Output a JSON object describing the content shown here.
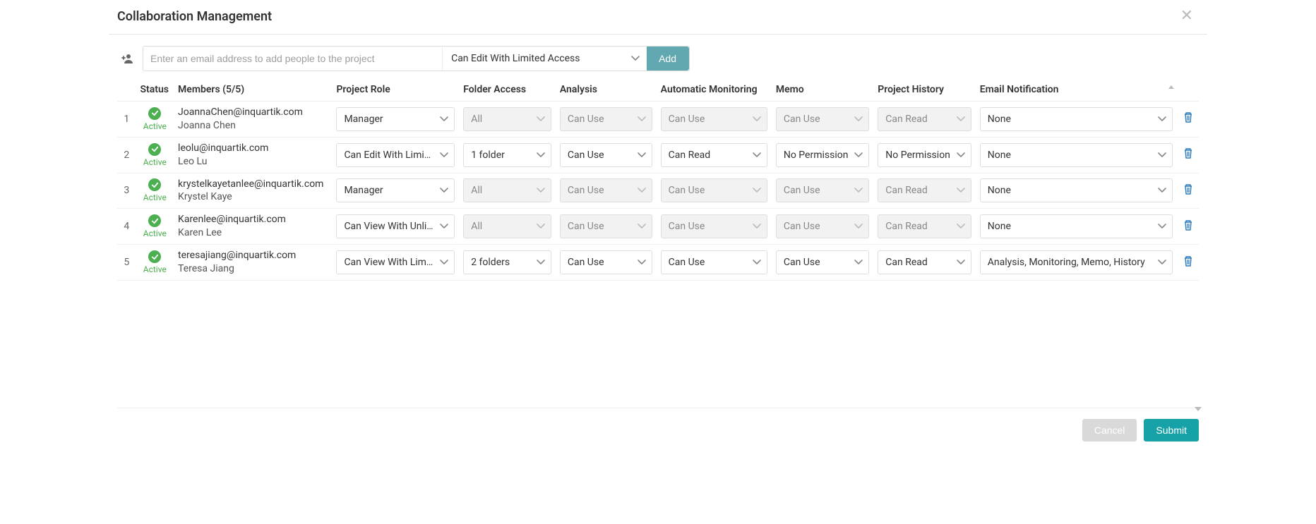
{
  "title": "Collaboration Management",
  "addRow": {
    "placeholder": "Enter an email address to add people to the project",
    "roleSelected": "Can Edit With Limited Access",
    "addLabel": "Add"
  },
  "columns": {
    "status": "Status",
    "members": "Members (5/5)",
    "role": "Project Role",
    "folder": "Folder Access",
    "analysis": "Analysis",
    "monitoring": "Automatic Monitoring",
    "memo": "Memo",
    "history": "Project History",
    "emailNotif": "Email Notification"
  },
  "statusLabel": "Active",
  "rows": [
    {
      "idx": "1",
      "email": "JoannaChen@inquartik.com",
      "name": "Joanna Chen",
      "role": {
        "value": "Manager",
        "disabled": false
      },
      "folder": {
        "value": "All",
        "disabled": true
      },
      "analysis": {
        "value": "Can Use",
        "disabled": true
      },
      "monitoring": {
        "value": "Can Use",
        "disabled": true
      },
      "memo": {
        "value": "Can Use",
        "disabled": true
      },
      "history": {
        "value": "Can Read",
        "disabled": true
      },
      "emailNotif": {
        "value": "None",
        "disabled": false
      }
    },
    {
      "idx": "2",
      "email": "leolu@inquartik.com",
      "name": "Leo Lu",
      "role": {
        "value": "Can Edit With Limi…",
        "disabled": false
      },
      "folder": {
        "value": "1  folder",
        "disabled": false
      },
      "analysis": {
        "value": "Can Use",
        "disabled": false
      },
      "monitoring": {
        "value": "Can Read",
        "disabled": false
      },
      "memo": {
        "value": "No Permission",
        "disabled": false
      },
      "history": {
        "value": "No Permission",
        "disabled": false
      },
      "emailNotif": {
        "value": "None",
        "disabled": false
      }
    },
    {
      "idx": "3",
      "email": "krystelkayetanlee@inquartik.com",
      "name": "Krystel Kaye",
      "role": {
        "value": "Manager",
        "disabled": false
      },
      "folder": {
        "value": "All",
        "disabled": true
      },
      "analysis": {
        "value": "Can Use",
        "disabled": true
      },
      "monitoring": {
        "value": "Can Use",
        "disabled": true
      },
      "memo": {
        "value": "Can Use",
        "disabled": true
      },
      "history": {
        "value": "Can Read",
        "disabled": true
      },
      "emailNotif": {
        "value": "None",
        "disabled": false
      }
    },
    {
      "idx": "4",
      "email": "Karenlee@inquartik.com",
      "name": "Karen Lee",
      "role": {
        "value": "Can View With Unli…",
        "disabled": false
      },
      "folder": {
        "value": "All",
        "disabled": true
      },
      "analysis": {
        "value": "Can Use",
        "disabled": true
      },
      "monitoring": {
        "value": "Can Use",
        "disabled": true
      },
      "memo": {
        "value": "Can Use",
        "disabled": true
      },
      "history": {
        "value": "Can Read",
        "disabled": true
      },
      "emailNotif": {
        "value": "None",
        "disabled": false
      }
    },
    {
      "idx": "5",
      "email": "teresajiang@inquartik.com",
      "name": "Teresa Jiang",
      "role": {
        "value": "Can View With Lim…",
        "disabled": false
      },
      "folder": {
        "value": "2  folders",
        "disabled": false
      },
      "analysis": {
        "value": "Can Use",
        "disabled": false
      },
      "monitoring": {
        "value": "Can Use",
        "disabled": false
      },
      "memo": {
        "value": "Can Use",
        "disabled": false
      },
      "history": {
        "value": "Can Read",
        "disabled": false
      },
      "emailNotif": {
        "value": "Analysis,  Monitoring,  Memo,  History",
        "disabled": false
      }
    }
  ],
  "footer": {
    "cancel": "Cancel",
    "submit": "Submit"
  }
}
